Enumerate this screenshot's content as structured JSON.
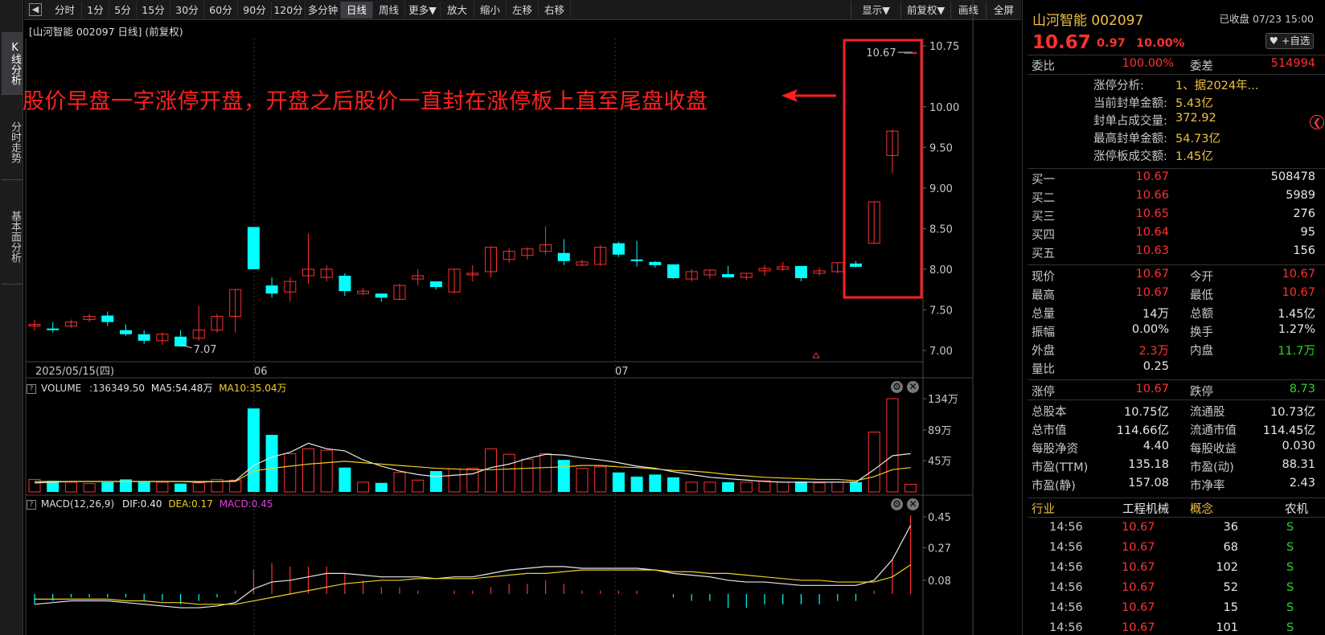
{
  "sidebar": {
    "tabs": [
      "K线分析",
      "分时走势",
      "基本面分析"
    ]
  },
  "toolbar": {
    "back": "◀",
    "periods": [
      "分时",
      "1分",
      "5分",
      "15分",
      "30分",
      "60分",
      "90分",
      "120分",
      "多分钟",
      "日线",
      "周线",
      "更多▼",
      "放大",
      "缩小",
      "左移",
      "右移"
    ],
    "active": "日线",
    "right_buttons": [
      "显示▼",
      "前复权▼",
      "画线",
      "全屏"
    ]
  },
  "chart": {
    "title": "[山河智能 002097 日线] (前复权)",
    "price_axis": [
      "10.75",
      "10.00",
      "9.50",
      "9.00",
      "8.50",
      "8.00",
      "7.50",
      "7.00"
    ],
    "min_label": "7.07",
    "max_label": "10.67",
    "date_axis": [
      "2025/05/15(四)",
      "06",
      "07"
    ],
    "annotation": "股价早盘一字涨停开盘，开盘之后股价一直封在涨停板上直至尾盘收盘"
  },
  "volume_panel": {
    "title": "VOLUME",
    "vol": ":136349.50",
    "ma5": "MA5:54.48万",
    "ma10": "MA10:35.04万",
    "axis": [
      "134万",
      "89万",
      "45万"
    ]
  },
  "macd_panel": {
    "title": "MACD(12,26,9)",
    "dif": "DIF:0.40",
    "dea": "DEA:0.17",
    "macd": "MACD:0.45",
    "axis": [
      "0.45",
      "0.27",
      "0.08"
    ]
  },
  "quote": {
    "name": "山河智能 002097",
    "status": "已收盘 07/23 15:00",
    "price": "10.67",
    "change": "0.97",
    "pct": "10.00%",
    "fav": "♥ +自选",
    "weibi_label": "委比",
    "weibi": "100.00%",
    "weicha_label": "委差",
    "weicha": "514994",
    "limit_info": [
      {
        "label": "涨停分析:",
        "value": "1、据2024年..."
      },
      {
        "label": "当前封单金额:",
        "value": "5.43亿"
      },
      {
        "label": "封单占成交量:",
        "value": "372.92"
      },
      {
        "label": "最高封单金额:",
        "value": "54.73亿"
      },
      {
        "label": "涨停板成交额:",
        "value": "1.45亿"
      }
    ],
    "bids": [
      {
        "label": "买一",
        "price": "10.67",
        "vol": "508478"
      },
      {
        "label": "买二",
        "price": "10.66",
        "vol": "5989"
      },
      {
        "label": "买三",
        "price": "10.65",
        "vol": "276"
      },
      {
        "label": "买四",
        "price": "10.64",
        "vol": "95"
      },
      {
        "label": "买五",
        "price": "10.63",
        "vol": "156"
      }
    ],
    "stats": [
      {
        "l1": "现价",
        "v1": "10.67",
        "c1": "red",
        "l2": "今开",
        "v2": "10.67",
        "c2": "red"
      },
      {
        "l1": "最高",
        "v1": "10.67",
        "c1": "red",
        "l2": "最低",
        "v2": "10.67",
        "c2": "red"
      },
      {
        "l1": "总量",
        "v1": "14万",
        "c1": "wht",
        "l2": "总额",
        "v2": "1.45亿",
        "c2": "wht"
      },
      {
        "l1": "振幅",
        "v1": "0.00%",
        "c1": "wht",
        "l2": "换手",
        "v2": "1.27%",
        "c2": "wht"
      },
      {
        "l1": "外盘",
        "v1": "2.3万",
        "c1": "red",
        "l2": "内盘",
        "v2": "11.7万",
        "c2": "grn"
      },
      {
        "l1": "量比",
        "v1": "0.25",
        "c1": "wht",
        "l2": "",
        "v2": "",
        "c2": "wht"
      }
    ],
    "limits": {
      "up_label": "涨停",
      "up": "10.67",
      "down_label": "跌停",
      "down": "8.73"
    },
    "fund": [
      {
        "l1": "总股本",
        "v1": "10.75亿",
        "l2": "流通股",
        "v2": "10.73亿"
      },
      {
        "l1": "总市值",
        "v1": "114.66亿",
        "l2": "流通市值",
        "v2": "114.45亿"
      },
      {
        "l1": "每股净资",
        "v1": "4.40",
        "l2": "每股收益",
        "v2": "0.030"
      },
      {
        "l1": "市盈(TTM)",
        "v1": "135.18",
        "l2": "市盈(动)",
        "v2": "88.31"
      },
      {
        "l1": "市盈(静)",
        "v1": "157.08",
        "l2": "市净率",
        "v2": "2.43"
      }
    ],
    "industry": {
      "label": "行业",
      "value": "工程机械",
      "concept_label": "概念",
      "concept": "农机"
    },
    "ticks": [
      {
        "time": "14:56",
        "price": "10.67",
        "vol": "36",
        "side": "S"
      },
      {
        "time": "14:56",
        "price": "10.67",
        "vol": "68",
        "side": "S"
      },
      {
        "time": "14:56",
        "price": "10.67",
        "vol": "102",
        "side": "S"
      },
      {
        "time": "14:56",
        "price": "10.67",
        "vol": "52",
        "side": "S"
      },
      {
        "time": "14:56",
        "price": "10.67",
        "vol": "15",
        "side": "S"
      },
      {
        "time": "14:56",
        "price": "10.67",
        "vol": "101",
        "side": "S"
      }
    ]
  },
  "chart_data": {
    "type": "candlestick",
    "candles": [
      [
        7.3,
        7.38,
        7.24,
        7.32
      ],
      [
        7.27,
        7.35,
        7.22,
        7.25
      ],
      [
        7.3,
        7.38,
        7.28,
        7.35
      ],
      [
        7.38,
        7.45,
        7.35,
        7.42
      ],
      [
        7.43,
        7.48,
        7.3,
        7.35
      ],
      [
        7.25,
        7.32,
        7.18,
        7.2
      ],
      [
        7.2,
        7.25,
        7.08,
        7.12
      ],
      [
        7.12,
        7.22,
        7.07,
        7.2
      ],
      [
        7.17,
        7.25,
        7.07,
        7.05
      ],
      [
        7.15,
        7.55,
        7.12,
        7.25
      ],
      [
        7.25,
        7.45,
        7.22,
        7.42
      ],
      [
        7.42,
        7.75,
        7.22,
        7.75
      ],
      [
        8.52,
        8.52,
        8.0,
        8.0
      ],
      [
        7.8,
        7.9,
        7.65,
        7.7
      ],
      [
        7.72,
        7.9,
        7.6,
        7.85
      ],
      [
        7.92,
        8.44,
        7.82,
        8.0
      ],
      [
        7.9,
        8.05,
        7.85,
        8.0
      ],
      [
        7.92,
        7.95,
        7.67,
        7.73
      ],
      [
        7.7,
        7.77,
        7.68,
        7.73
      ],
      [
        7.7,
        7.7,
        7.6,
        7.65
      ],
      [
        7.63,
        7.82,
        7.62,
        7.8
      ],
      [
        7.88,
        8.0,
        7.8,
        7.92
      ],
      [
        7.85,
        7.85,
        7.75,
        7.78
      ],
      [
        7.72,
        8.0,
        7.7,
        8.0
      ],
      [
        7.93,
        8.05,
        7.85,
        7.95
      ],
      [
        7.97,
        8.28,
        7.9,
        8.27
      ],
      [
        8.12,
        8.26,
        8.08,
        8.22
      ],
      [
        8.17,
        8.27,
        8.12,
        8.25
      ],
      [
        8.22,
        8.53,
        8.18,
        8.3
      ],
      [
        8.2,
        8.37,
        8.05,
        8.1
      ],
      [
        8.05,
        8.12,
        8.04,
        8.09
      ],
      [
        8.06,
        8.3,
        8.04,
        8.27
      ],
      [
        8.32,
        8.34,
        8.15,
        8.18
      ],
      [
        8.12,
        8.35,
        8.03,
        8.1
      ],
      [
        8.09,
        8.1,
        8.02,
        8.05
      ],
      [
        8.06,
        8.06,
        7.88,
        7.89
      ],
      [
        7.88,
        8.0,
        7.85,
        7.97
      ],
      [
        7.93,
        8.0,
        7.88,
        7.99
      ],
      [
        7.94,
        8.04,
        7.9,
        7.9
      ],
      [
        7.9,
        7.95,
        7.87,
        7.95
      ],
      [
        7.98,
        8.05,
        7.92,
        8.01
      ],
      [
        8.0,
        8.09,
        7.98,
        8.03
      ],
      [
        8.04,
        8.04,
        7.85,
        7.89
      ],
      [
        7.95,
        8.02,
        7.92,
        7.98
      ],
      [
        7.97,
        8.09,
        7.95,
        8.08
      ],
      [
        8.07,
        8.1,
        8.02,
        8.03
      ],
      [
        8.32,
        8.83,
        8.32,
        8.83
      ],
      [
        9.4,
        9.72,
        9.18,
        9.7
      ],
      [
        10.67,
        10.67,
        10.67,
        10.67
      ]
    ],
    "volume": [
      18,
      16,
      14,
      12,
      14,
      18,
      15,
      14,
      12,
      13,
      18,
      17,
      120,
      82,
      55,
      62,
      60,
      35,
      14,
      13,
      28,
      17,
      30,
      33,
      34,
      62,
      54,
      47,
      55,
      46,
      34,
      36,
      28,
      22,
      25,
      21,
      14,
      14,
      14,
      14,
      16,
      14,
      15,
      13,
      14,
      14,
      86,
      134,
      11
    ],
    "ma5": [
      13,
      14,
      15,
      15,
      15,
      15,
      15,
      15,
      15,
      14,
      15,
      16,
      38,
      50,
      57,
      70,
      62,
      59,
      46,
      37,
      30,
      25,
      22,
      24,
      26,
      35,
      40,
      48,
      54,
      53,
      49,
      46,
      42,
      37,
      34,
      29,
      25,
      21,
      19,
      17,
      15,
      14,
      14,
      14,
      14,
      14,
      32,
      52,
      55
    ],
    "ma10": [
      15,
      15,
      15,
      15,
      15,
      15,
      15,
      15,
      15,
      15,
      15,
      15,
      30,
      34,
      37,
      40,
      42,
      44,
      42,
      40,
      38,
      36,
      34,
      33,
      32,
      32,
      33,
      34,
      35,
      36,
      38,
      38,
      36,
      35,
      33,
      31,
      30,
      28,
      25,
      23,
      21,
      20,
      19,
      18,
      18,
      16,
      22,
      32,
      35
    ],
    "macd_dif": [
      -0.06,
      -0.05,
      -0.04,
      -0.04,
      -0.04,
      -0.05,
      -0.06,
      -0.07,
      -0.08,
      -0.08,
      -0.07,
      -0.05,
      0.03,
      0.07,
      0.08,
      0.1,
      0.12,
      0.12,
      0.11,
      0.1,
      0.1,
      0.1,
      0.09,
      0.1,
      0.1,
      0.12,
      0.14,
      0.15,
      0.16,
      0.16,
      0.15,
      0.15,
      0.15,
      0.15,
      0.14,
      0.12,
      0.11,
      0.1,
      0.08,
      0.07,
      0.07,
      0.06,
      0.05,
      0.05,
      0.05,
      0.05,
      0.08,
      0.2,
      0.4
    ],
    "macd_dea": [
      -0.03,
      -0.03,
      -0.03,
      -0.03,
      -0.03,
      -0.04,
      -0.04,
      -0.05,
      -0.05,
      -0.06,
      -0.06,
      -0.06,
      -0.04,
      -0.02,
      0.0,
      0.02,
      0.04,
      0.06,
      0.07,
      0.08,
      0.08,
      0.09,
      0.09,
      0.09,
      0.09,
      0.1,
      0.11,
      0.12,
      0.12,
      0.13,
      0.14,
      0.14,
      0.14,
      0.14,
      0.14,
      0.13,
      0.13,
      0.12,
      0.12,
      0.11,
      0.1,
      0.09,
      0.08,
      0.08,
      0.07,
      0.07,
      0.07,
      0.1,
      0.17
    ],
    "ylim": [
      6.97,
      10.85
    ]
  }
}
